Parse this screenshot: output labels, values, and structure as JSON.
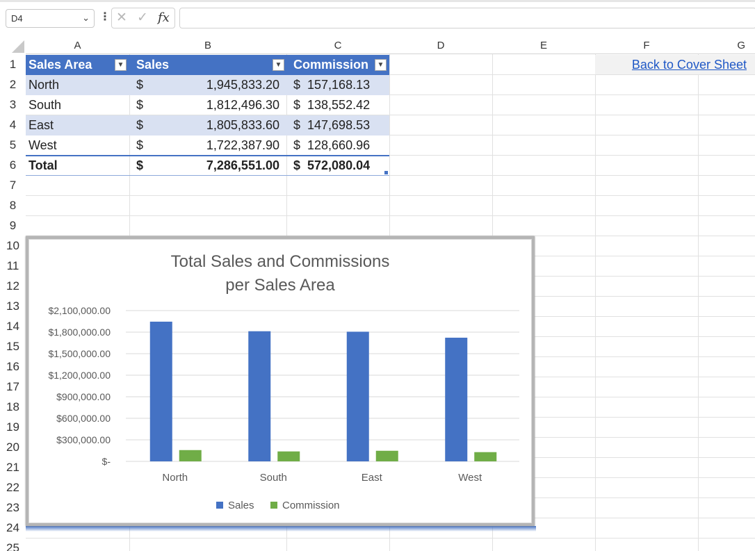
{
  "formula_bar": {
    "name_box": "D4",
    "fx": "fx",
    "formula": ""
  },
  "columns": [
    "A",
    "B",
    "C",
    "D",
    "E",
    "F",
    "G"
  ],
  "rows": [
    "1",
    "2",
    "3",
    "4",
    "5",
    "6",
    "7",
    "8",
    "9",
    "10",
    "11",
    "12",
    "13",
    "14",
    "15",
    "16",
    "17",
    "18",
    "19",
    "20",
    "21",
    "22",
    "23",
    "24",
    "25"
  ],
  "table": {
    "headers": [
      "Sales Area",
      "Sales",
      "Commission"
    ],
    "rows": [
      {
        "area": "North",
        "cur": "$",
        "sales": "1,945,833.20",
        "commission": "$  157,168.13"
      },
      {
        "area": "South",
        "cur": "$",
        "sales": "1,812,496.30",
        "commission": "$  138,552.42"
      },
      {
        "area": "East",
        "cur": "$",
        "sales": "1,805,833.60",
        "commission": "$  147,698.53"
      },
      {
        "area": "West",
        "cur": "$",
        "sales": "1,722,387.90",
        "commission": "$  128,660.96"
      }
    ],
    "total": {
      "area": "Total",
      "cur": "$",
      "sales": "7,286,551.00",
      "commission": "$  572,080.04"
    }
  },
  "link": "Back to Cover Sheet",
  "colors": {
    "sales": "#4472c4",
    "commission": "#70ad47",
    "header": "#4472c4",
    "band": "#d9e1f2"
  },
  "chart_data": {
    "type": "bar",
    "title": "Total Sales and Commissions per Sales Area",
    "title_lines": [
      "Total Sales and Commissions",
      "per Sales Area"
    ],
    "categories": [
      "North",
      "South",
      "East",
      "West"
    ],
    "series": [
      {
        "name": "Sales",
        "values": [
          1945833.2,
          1812496.3,
          1805833.6,
          1722387.9
        ],
        "color": "#4472c4"
      },
      {
        "name": "Commission",
        "values": [
          157168.13,
          138552.42,
          147698.53,
          128660.96
        ],
        "color": "#70ad47"
      }
    ],
    "ylim": [
      0,
      2100000
    ],
    "yticks": [
      0,
      300000,
      600000,
      900000,
      1200000,
      1500000,
      1800000,
      2100000
    ],
    "ytick_labels": [
      "$-",
      "$300,000.00",
      "$600,000.00",
      "$900,000.00",
      "$1,200,000.00",
      "$1,500,000.00",
      "$1,800,000.00",
      "$2,100,000.00"
    ],
    "grid": true,
    "legend": "bottom"
  }
}
